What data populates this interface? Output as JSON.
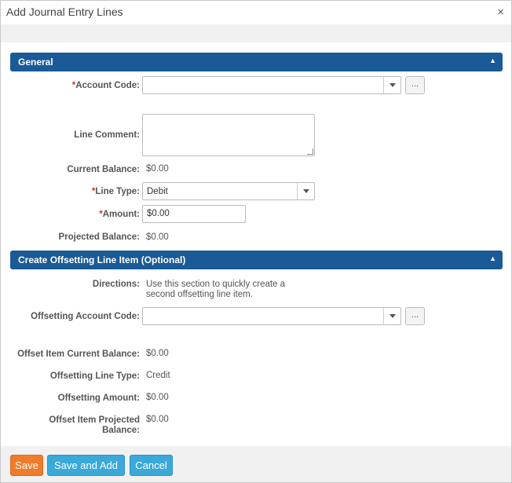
{
  "dialog": {
    "title": "Add Journal Entry Lines",
    "close_glyph": "×"
  },
  "general": {
    "header": "General",
    "collapse_glyph": "▲",
    "account_code": {
      "required_mark": "*",
      "label": "Account Code:",
      "value": "",
      "ellipsis": "..."
    },
    "line_comment": {
      "label": "Line Comment:",
      "value": ""
    },
    "current_balance": {
      "label": "Current Balance:",
      "value": "$0.00"
    },
    "line_type": {
      "required_mark": "*",
      "label": "Line Type:",
      "value": "Debit"
    },
    "amount": {
      "required_mark": "*",
      "label": "Amount:",
      "value": "$0.00"
    },
    "projected_balance": {
      "label": "Projected Balance:",
      "value": "$0.00"
    }
  },
  "offset": {
    "header": "Create Offsetting Line Item (Optional)",
    "collapse_glyph": "▲",
    "directions": {
      "label": "Directions:",
      "line1": "Use this section to quickly create a",
      "line2": "second offsetting line item."
    },
    "offsetting_account_code": {
      "label": "Offsetting Account Code:",
      "value": "",
      "ellipsis": "..."
    },
    "offset_current_balance": {
      "label": "Offset Item Current Balance:",
      "value": "$0.00"
    },
    "offsetting_line_type": {
      "label": "Offsetting Line Type:",
      "value": "Credit"
    },
    "offsetting_amount": {
      "label": "Offsetting Amount:",
      "value": "$0.00"
    },
    "offset_projected_balance": {
      "label_line1": "Offset Item Projected",
      "label_line2": "Balance:",
      "value": "$0.00"
    }
  },
  "footer": {
    "save_label": "Save",
    "save_and_add_label": "Save and Add",
    "cancel_label": "Cancel"
  },
  "colors": {
    "section_header": "#1a5a96",
    "save_button": "#ef7c2c",
    "secondary_buttons": "#3aa9d9",
    "required_mark": "#c0392b"
  }
}
